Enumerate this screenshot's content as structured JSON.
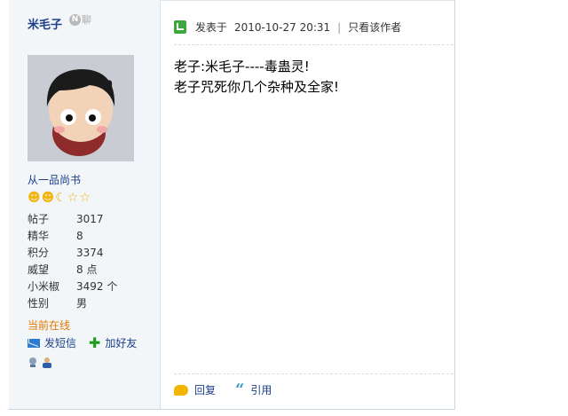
{
  "author": {
    "username": "米毛子",
    "chat_label": "聊",
    "rank": "从一品尚书",
    "stats": [
      {
        "label": "帖子",
        "value": "3017"
      },
      {
        "label": "精华",
        "value": "8"
      },
      {
        "label": "积分",
        "value": "3374"
      },
      {
        "label": "威望",
        "value": "8 点"
      },
      {
        "label": "小米椒",
        "value": "3492 个"
      },
      {
        "label": "性别",
        "value": "男"
      }
    ],
    "online_status": "当前在线",
    "send_message_label": "发短信",
    "add_friend_label": "加好友"
  },
  "post": {
    "posted_prefix": "发表于",
    "posted_time": "2010-10-27 20:31",
    "separator": "|",
    "author_only_label": "只看该作者",
    "lines": [
      "老子:米毛子----毒蛊灵!",
      "老子咒死你几个杂种及全家!"
    ],
    "reply_label": "回复",
    "quote_label": "引用"
  },
  "colors": {
    "link": "#1b3f88",
    "online": "#e07800",
    "sidebar_bg": "#f3f6f9"
  }
}
